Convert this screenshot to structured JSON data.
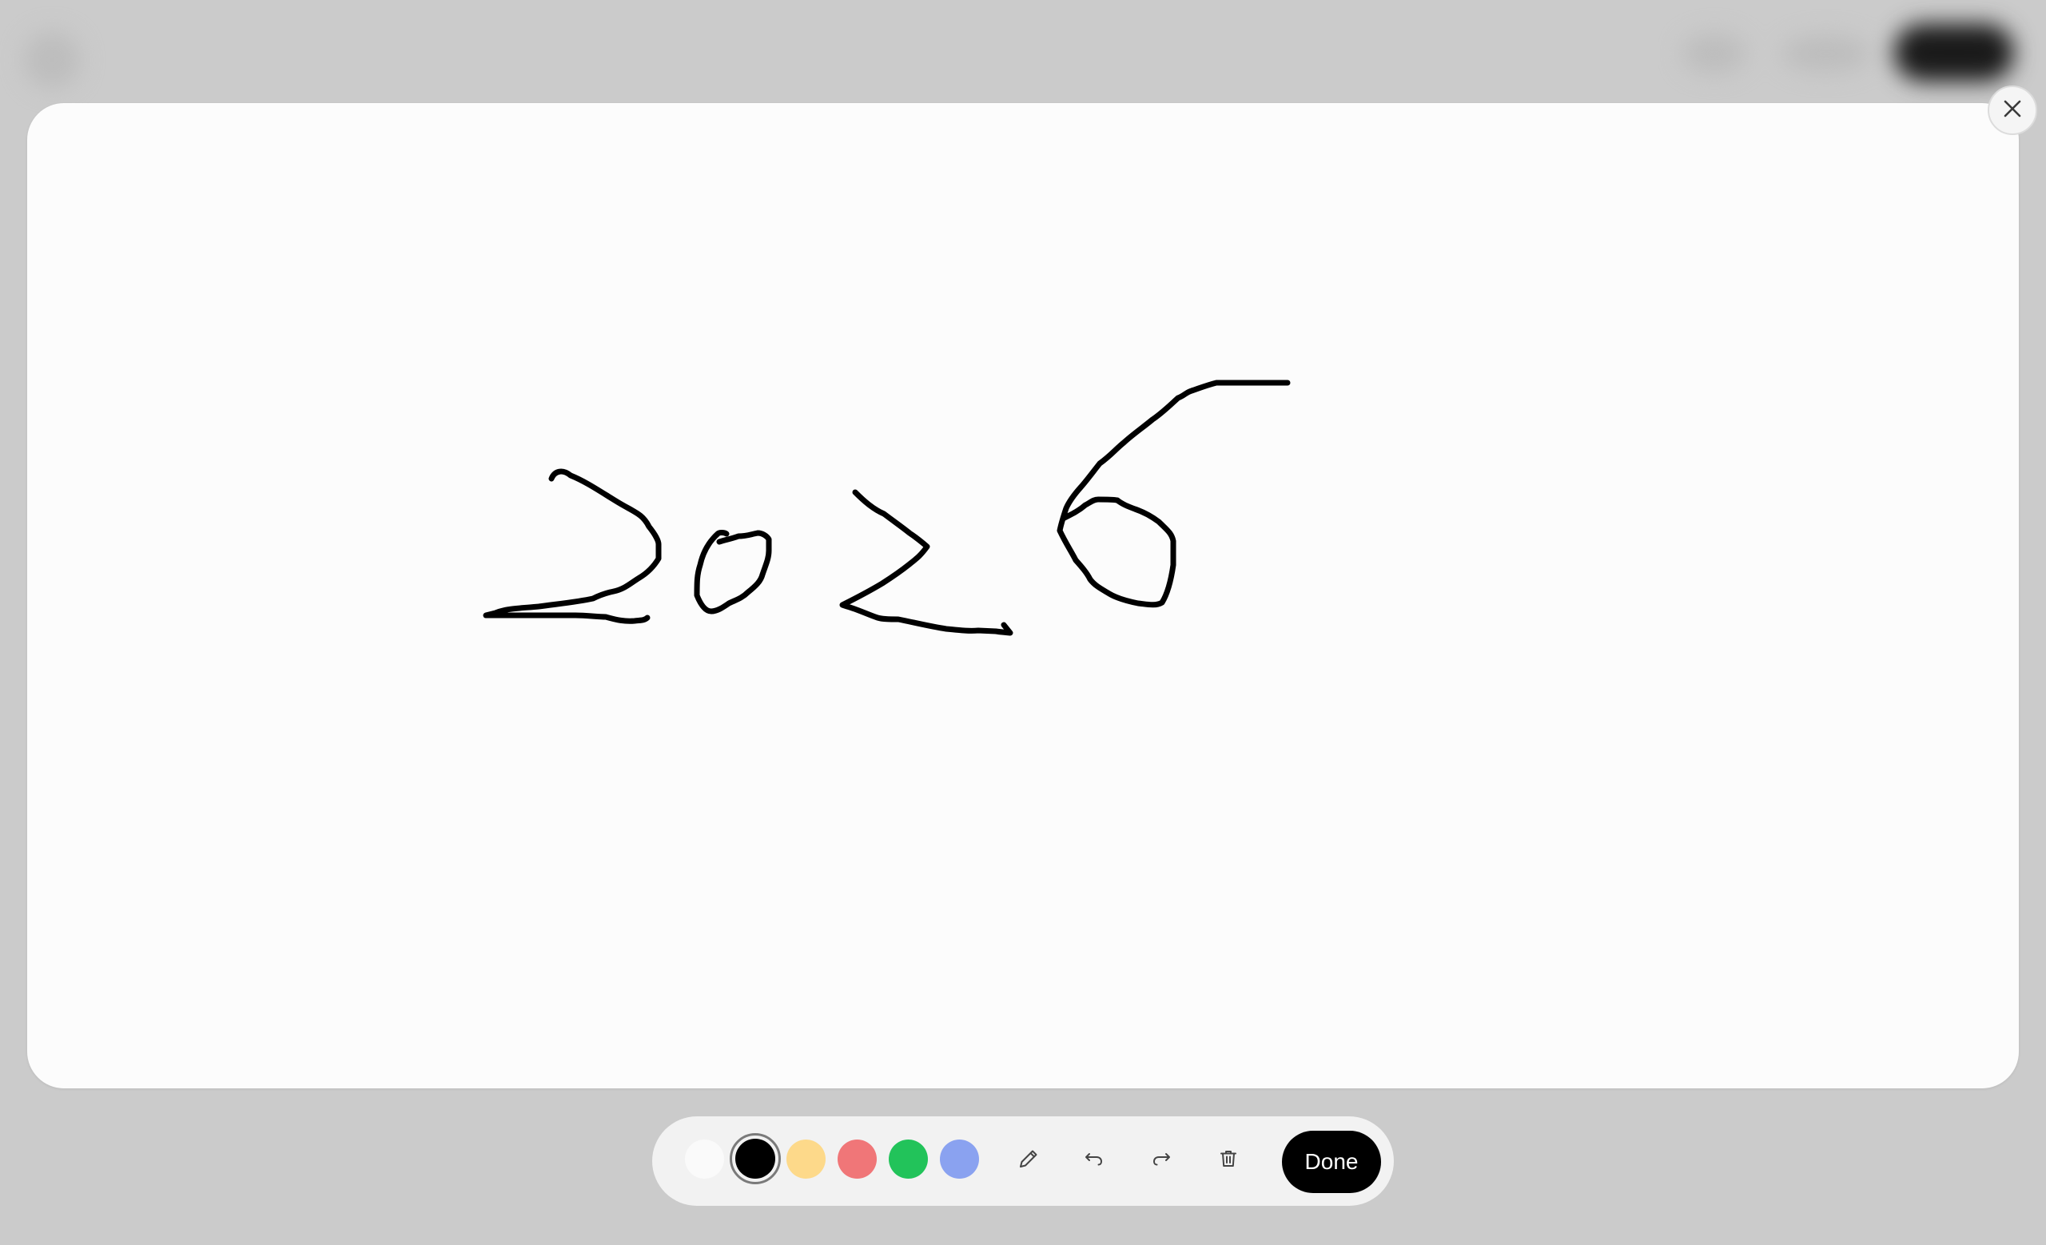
{
  "canvas": {
    "background": "#fcfcfc",
    "stroke_color": "#000000"
  },
  "close_button": {
    "icon": "close-icon"
  },
  "toolbar": {
    "colors": [
      {
        "name": "white",
        "hex": "#fafafa",
        "selected": false
      },
      {
        "name": "black",
        "hex": "#000000",
        "selected": true
      },
      {
        "name": "yellow",
        "hex": "#fdd98a",
        "selected": false
      },
      {
        "name": "red",
        "hex": "#f07678",
        "selected": false
      },
      {
        "name": "green",
        "hex": "#22c35a",
        "selected": false
      },
      {
        "name": "blue",
        "hex": "#8aa2f0",
        "selected": false
      }
    ],
    "tools": [
      {
        "name": "pen",
        "icon": "pencil-icon"
      },
      {
        "name": "undo",
        "icon": "undo-icon"
      },
      {
        "name": "redo",
        "icon": "redo-icon"
      },
      {
        "name": "clear",
        "icon": "trash-icon"
      }
    ],
    "done_label": "Done"
  }
}
